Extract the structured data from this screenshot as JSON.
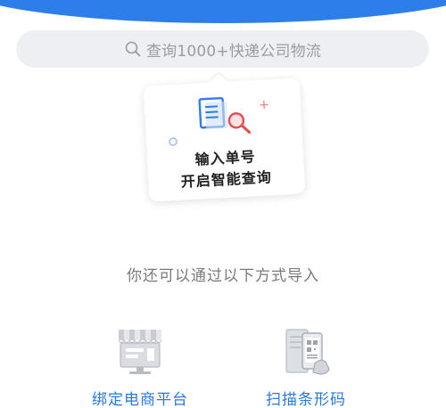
{
  "search": {
    "placeholder": "查询1000+快递公司物流"
  },
  "tip_card": {
    "line1": "输入单号",
    "line2": "开启智能查询"
  },
  "import_hint": "你还可以通过以下方式导入",
  "import_options": [
    {
      "label": "绑定电商平台",
      "icon": "storefront-icon"
    },
    {
      "label": "扫描条形码",
      "icon": "barcode-scan-icon"
    }
  ],
  "colors": {
    "header_blue": "#2d7ee8",
    "search_bg": "#eeeff3",
    "option_label": "#2a79e0",
    "document_icon_blue": "#2d7ee8",
    "magnifier_red": "#e84a4a"
  }
}
